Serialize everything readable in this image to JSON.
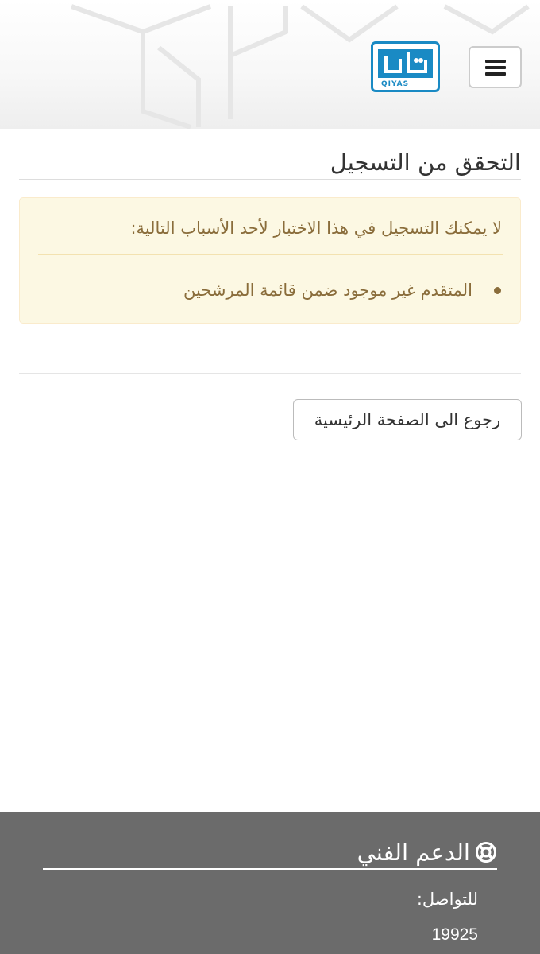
{
  "header": {
    "logo": {
      "wordmark": "قياس",
      "latin": "QIYAS",
      "accent": "#1a8ac4"
    },
    "menu_icon": "hamburger-icon"
  },
  "main": {
    "title": "التحقق من التسجيل",
    "alert": {
      "message": "لا يمكنك التسجيل في هذا الاختبار لأحد الأسباب التالية:",
      "reasons": [
        "المتقدم غير موجود ضمن قائمة المرشحين"
      ],
      "background": "#fcf8e3",
      "text_color": "#8a6d3b"
    },
    "home_button_label": "رجوع الى الصفحة الرئيسية"
  },
  "footer": {
    "heading": "الدعم الفني",
    "heading_icon": "lifebuoy-icon",
    "contact_label": "للتواصل:",
    "contact_number": "19925",
    "background": "#6b6b6b"
  }
}
